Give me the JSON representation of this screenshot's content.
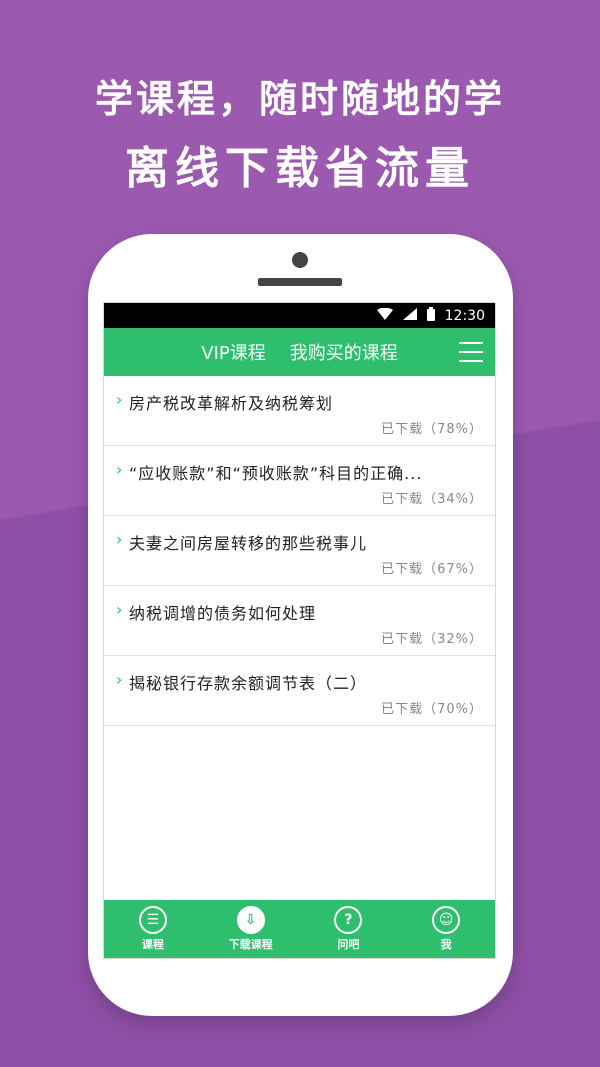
{
  "promo": {
    "line1": "学课程，随时随地的学",
    "line2": "离线下载省流量"
  },
  "statusbar": {
    "time": "12:30",
    "icons": [
      "wifi-icon",
      "signal-icon",
      "battery-icon"
    ]
  },
  "header": {
    "tab_vip": "VIP课程",
    "tab_bought": "我购买的课程",
    "menu_icon": "menu-icon"
  },
  "courses": [
    {
      "title": "房产税改革解析及纳税筹划",
      "status": "已下载（78%）"
    },
    {
      "title": "“应收账款”和“预收账款”科目的正确...",
      "status": "已下载（34%）"
    },
    {
      "title": "夫妻之间房屋转移的那些税事儿",
      "status": "已下载（67%）"
    },
    {
      "title": "纳税调增的债务如何处理",
      "status": "已下载（32%）"
    },
    {
      "title": "揭秘银行存款余额调节表（二）",
      "status": "已下载（70%）"
    }
  ],
  "tabbar": {
    "tabs": [
      {
        "label": "课程",
        "icon": "book-icon"
      },
      {
        "label": "下载课程",
        "icon": "download-icon",
        "active": true
      },
      {
        "label": "问吧",
        "icon": "question-icon"
      },
      {
        "label": "我",
        "icon": "profile-icon"
      }
    ]
  },
  "colors": {
    "background": "#9b59b0",
    "accent": "#2ebe6e"
  }
}
